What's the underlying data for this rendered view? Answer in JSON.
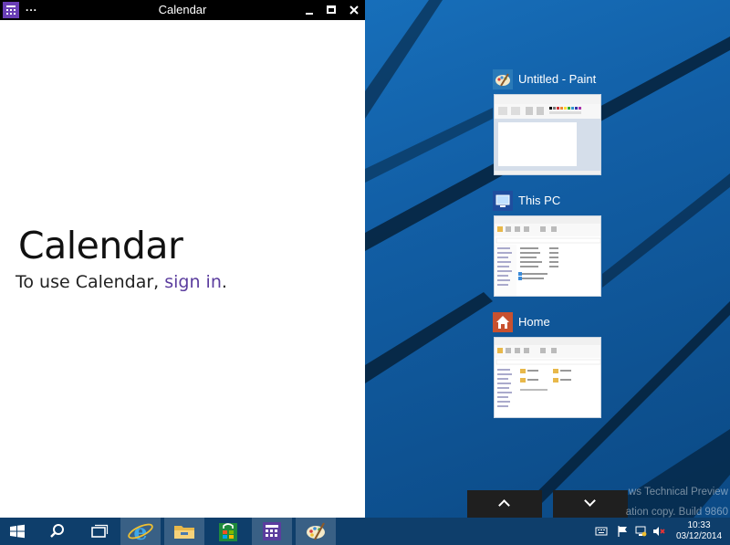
{
  "window": {
    "title": "Calendar",
    "menu_label": "...",
    "heading": "Calendar",
    "message_prefix": "To use Calendar, ",
    "signin_link": "sign in",
    "message_suffix": "."
  },
  "task_view": {
    "items": [
      {
        "label": "Untitled - Paint",
        "icon": "paint-icon"
      },
      {
        "label": "This PC",
        "icon": "this-pc-icon"
      },
      {
        "label": "Home",
        "icon": "home-icon"
      }
    ],
    "scroll_up_icon": "chevron-up-icon",
    "scroll_down_icon": "chevron-down-icon"
  },
  "watermark": {
    "line1": "ws Technical Preview",
    "line2": "ation copy. Build 9860"
  },
  "taskbar": {
    "buttons": [
      "start-icon",
      "search-icon",
      "task-view-icon",
      "internet-explorer-icon",
      "file-explorer-icon",
      "store-icon",
      "calendar-icon",
      "paint-icon"
    ],
    "tray": [
      "keyboard-icon",
      "action-center-flag-icon",
      "network-icon",
      "volume-muted-icon"
    ],
    "clock_time": "10:33",
    "clock_date": "03/12/2014"
  },
  "colors": {
    "accent": "#5b3d9e",
    "desktop": "#125fa6",
    "taskbar": "#0e3e6b",
    "titlebar": "#000000"
  }
}
